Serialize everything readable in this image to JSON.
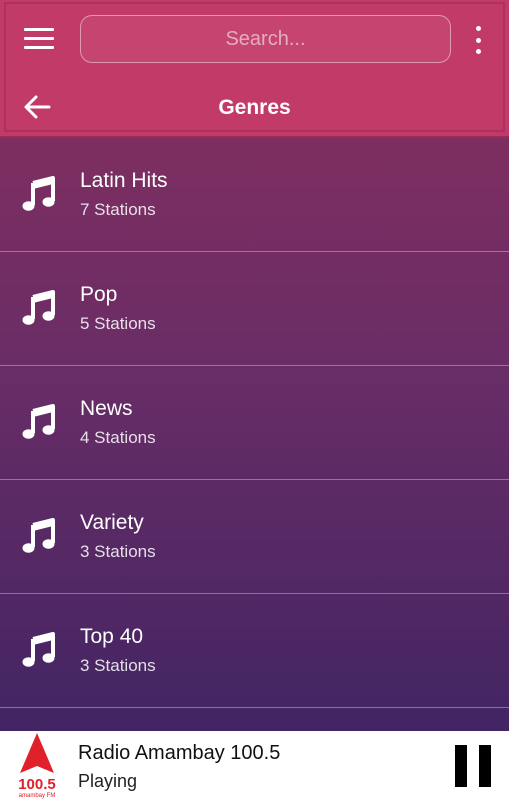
{
  "header": {
    "search": {
      "placeholder": "Search...",
      "value": ""
    },
    "title": "Genres",
    "icons": {
      "menu": "menu-icon",
      "more": "more-vert-icon",
      "back": "arrow-left-icon"
    }
  },
  "genres": [
    {
      "name": "Latin Hits",
      "count": "7 Stations"
    },
    {
      "name": "Pop",
      "count": "5 Stations"
    },
    {
      "name": "News",
      "count": "4 Stations"
    },
    {
      "name": "Variety",
      "count": "3 Stations"
    },
    {
      "name": "Top 40",
      "count": "3 Stations"
    }
  ],
  "player": {
    "station": "Radio Amambay 100.5",
    "status": "Playing",
    "logo": {
      "frequency": "100.5",
      "brand": "amambay FM"
    }
  },
  "colors": {
    "header": "#c23a68",
    "gradient_top": "#8a2e5c",
    "gradient_bottom": "#3b2363",
    "logo_red": "#e0202a"
  }
}
